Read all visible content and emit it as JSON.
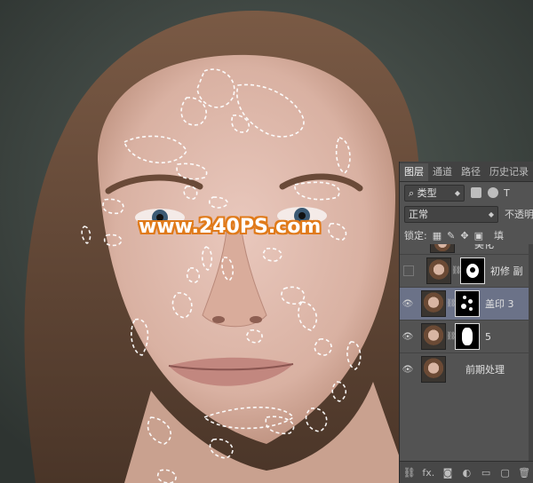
{
  "watermark": "www.240PS.com",
  "panel": {
    "tabs": [
      "图层",
      "通道",
      "路径",
      "历史记录"
    ],
    "filter": {
      "label": "类型"
    },
    "blend": {
      "mode": "正常",
      "opacity_label": "不透明"
    },
    "lock": {
      "label": "锁定:",
      "fill_label": "填"
    },
    "layers": [
      {
        "name": "美化",
        "visible": false
      },
      {
        "name": "初修 副",
        "visible": false
      },
      {
        "name": "盖印 3",
        "visible": true,
        "selected": true
      },
      {
        "name": "5",
        "visible": true
      },
      {
        "name": "前期处理",
        "visible": true
      }
    ],
    "bottom_icons": [
      "link-icon",
      "fx-icon",
      "mask-icon",
      "adjustment-icon",
      "group-icon",
      "new-layer-icon",
      "trash-icon"
    ],
    "fx_label": "fx."
  },
  "colors": {
    "panel_bg": "#535353",
    "selected_row": "#6b7288",
    "watermark_outline": "#e07a1a"
  }
}
